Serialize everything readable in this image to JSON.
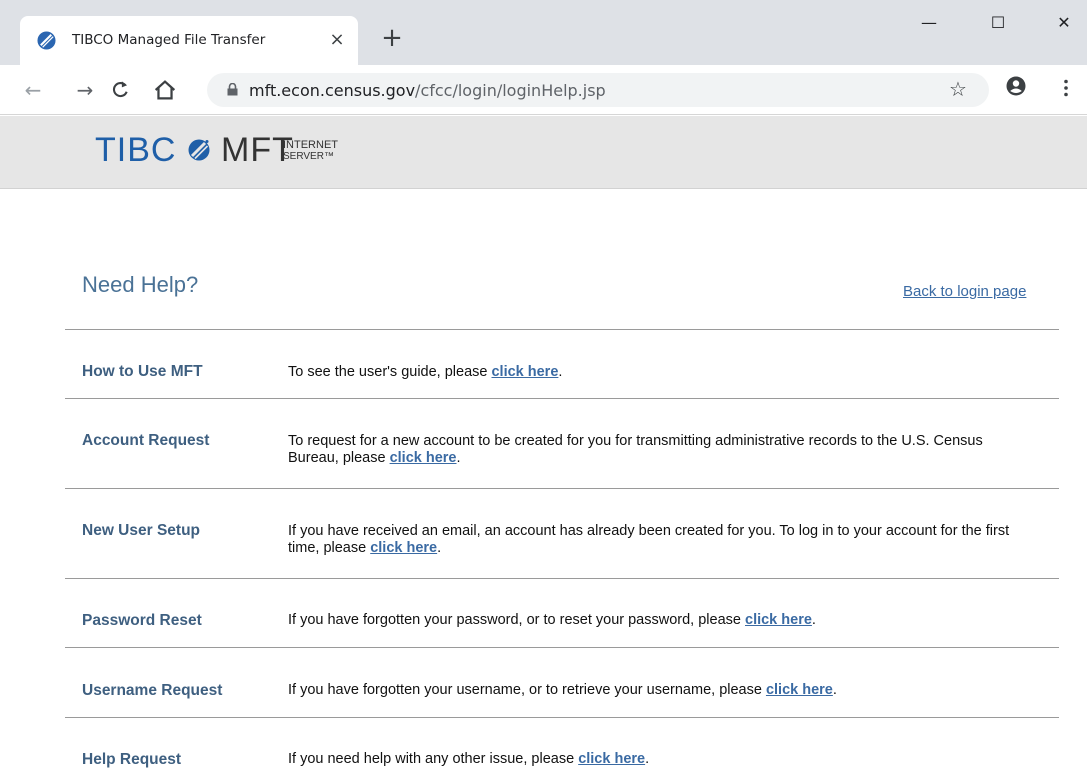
{
  "browser": {
    "tab_title": "TIBCO Managed File Transfer",
    "tab_close": "×",
    "new_tab": "+",
    "window_minimize": "—",
    "window_maximize": "☐",
    "window_close": "✕",
    "url_host": "mft.econ.census.gov",
    "url_path": "/cfcc/login/loginHelp.jsp",
    "icons": [
      "back-arrow-icon",
      "forward-arrow-icon",
      "reload-icon",
      "home-icon",
      "lock-icon",
      "star-icon",
      "profile-icon",
      "menu-icon"
    ]
  },
  "header": {
    "logo_tibco": "TIBC",
    "logo_mft": "MFT",
    "logo_sub_line1": "INTERNET",
    "logo_sub_line2": "SERVER™",
    "brand_color": "#1f5fa8"
  },
  "help": {
    "title": "Need Help?",
    "back_link": "Back to login page",
    "link_text": "click here",
    "rows": [
      {
        "label": "How to Use MFT",
        "text_before": "To see the user's guide, please ",
        "text_after": "."
      },
      {
        "label": "Account Request",
        "text_before": "To request for a new account to be created for you for transmitting administrative records to the U.S. Census Bureau, please ",
        "text_after": "."
      },
      {
        "label": "New User Setup",
        "text_before": "If you have received an email, an account has already been created for you. To log in to your account for the first time, please ",
        "text_after": "."
      },
      {
        "label": "Password Reset",
        "text_before": "If you have forgotten your password, or to reset your password, please ",
        "text_after": "."
      },
      {
        "label": "Username Request",
        "text_before": "If you have forgotten your username, or to retrieve your username, please ",
        "text_after": "."
      },
      {
        "label": "Help Request",
        "text_before": "If you need help with any other issue, please ",
        "text_after": "."
      }
    ],
    "colors": {
      "title": "#4a7296",
      "label": "#3e5f80",
      "link": "#3a6aa3"
    }
  }
}
